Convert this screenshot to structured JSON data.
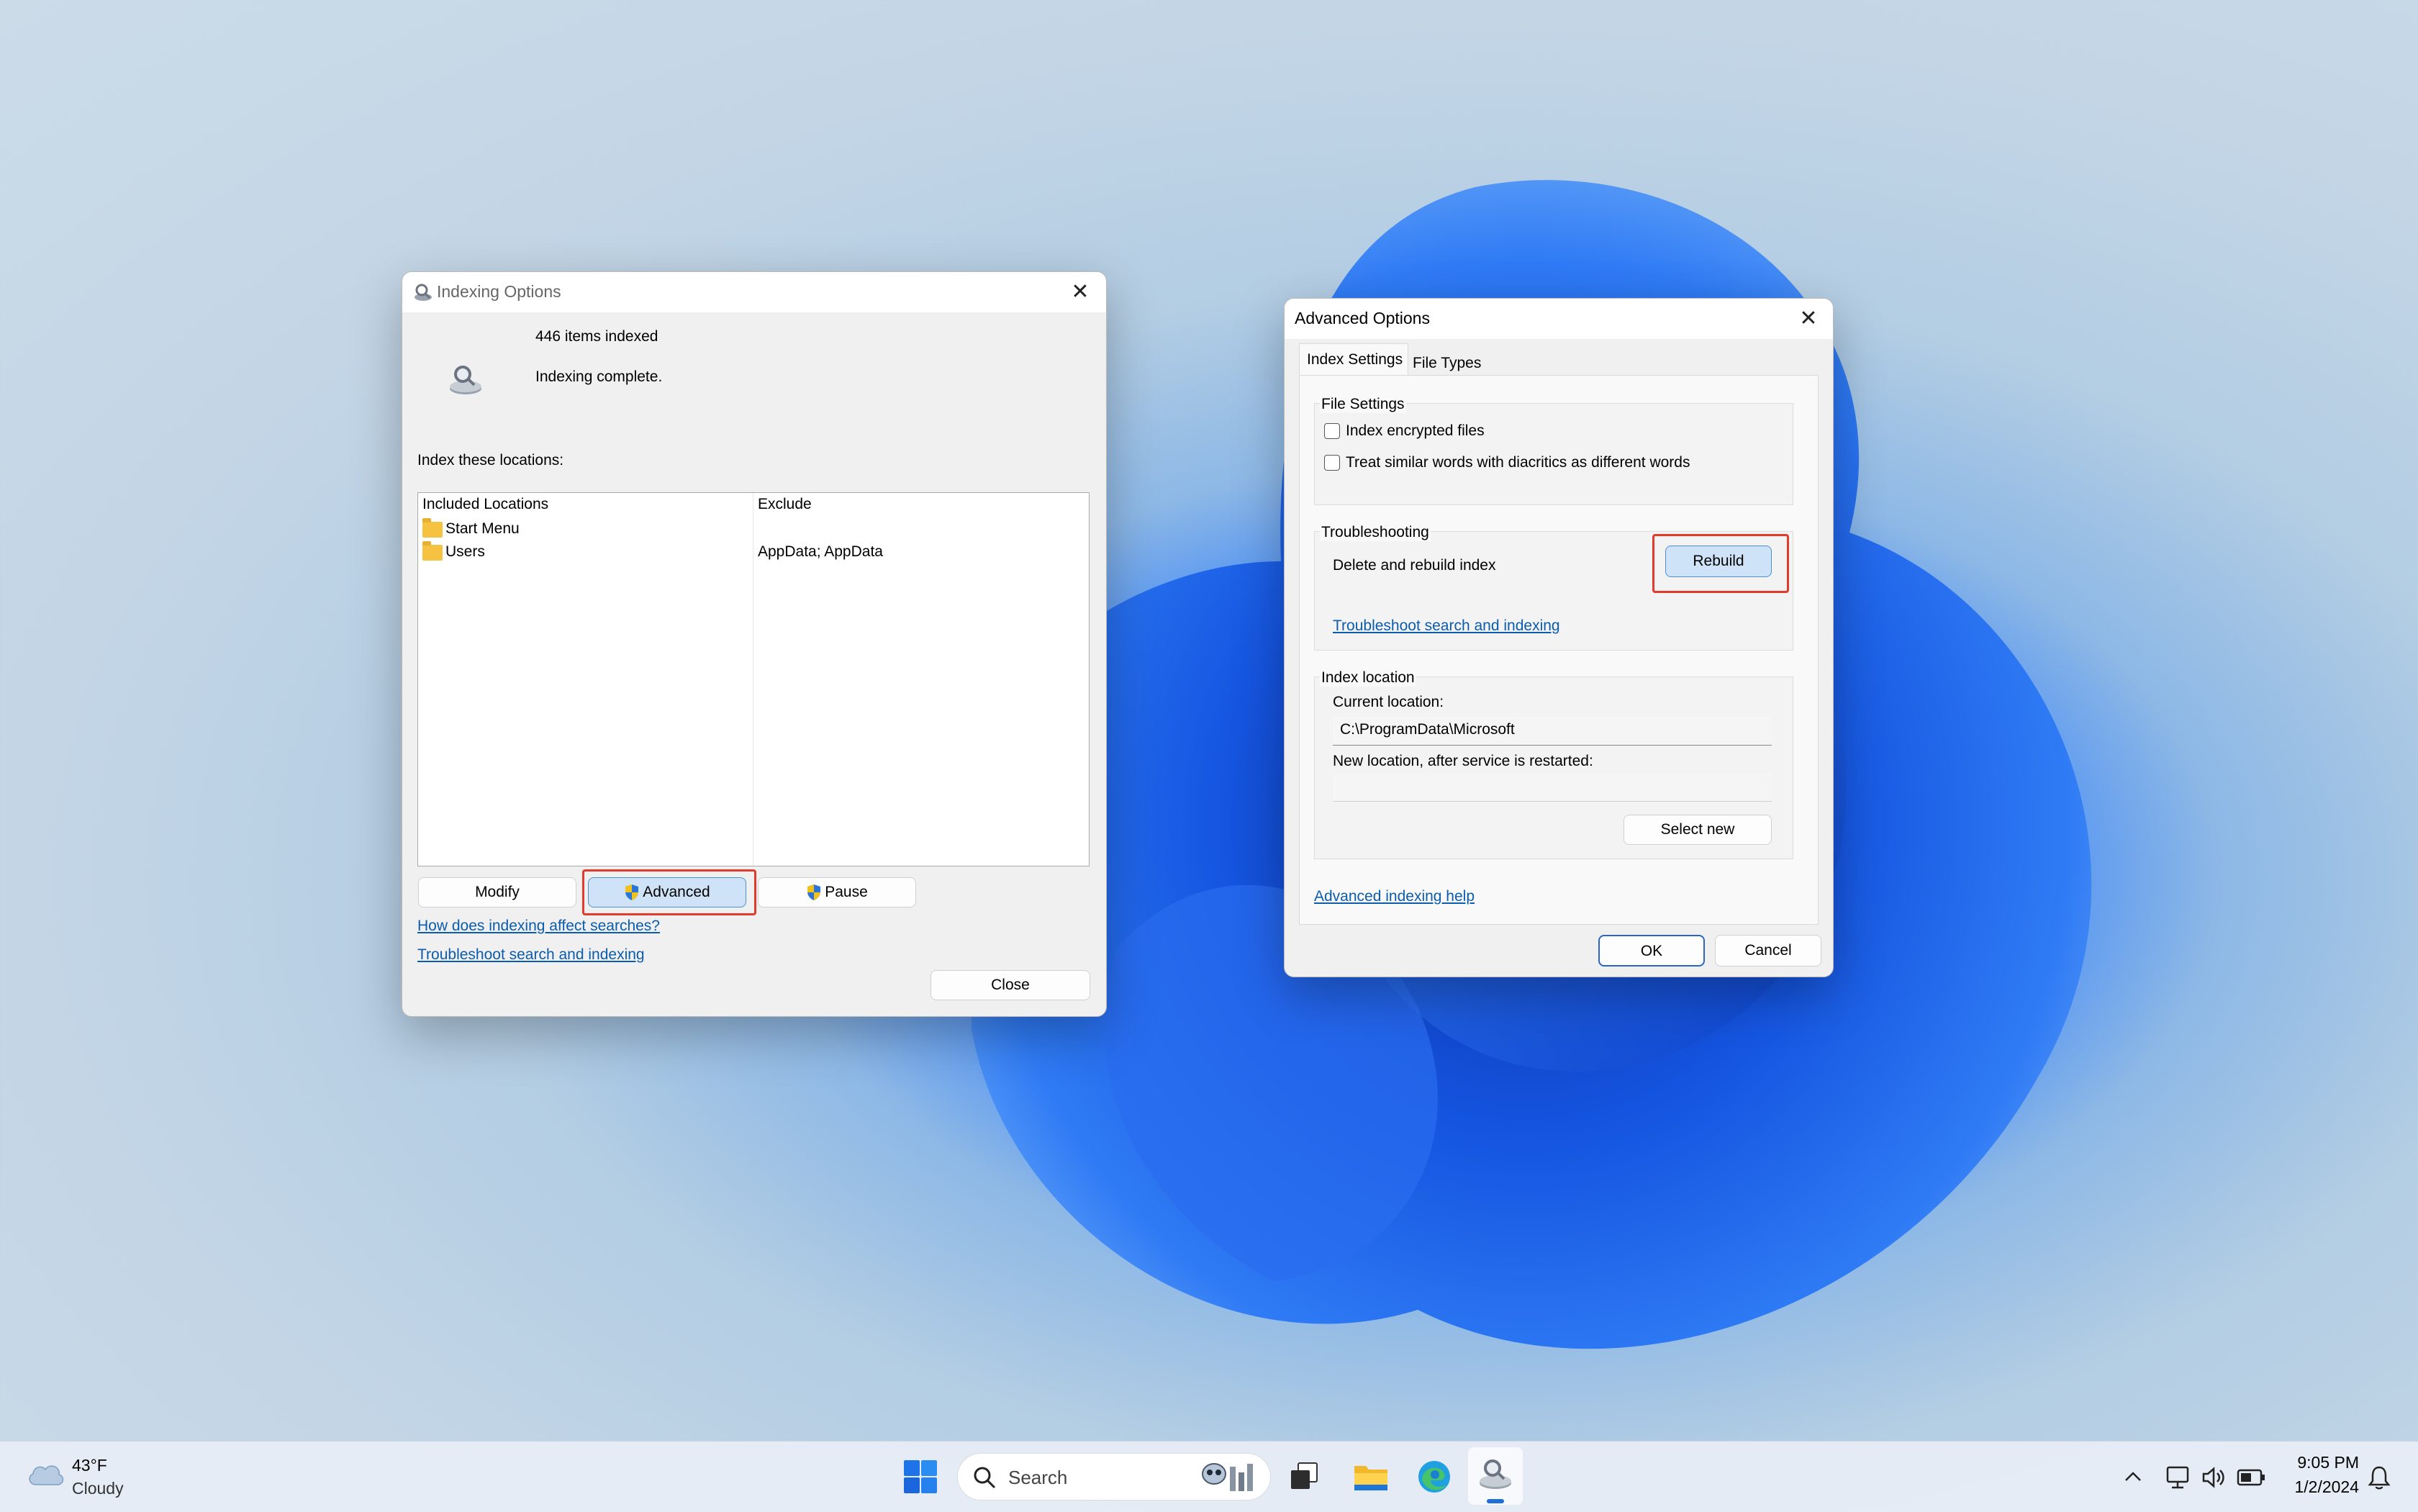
{
  "weather": {
    "temp": "43°F",
    "condition": "Cloudy"
  },
  "indexing_options": {
    "title": "Indexing Options",
    "items_indexed": "446 items indexed",
    "status": "Indexing complete.",
    "locations_label": "Index these locations:",
    "columns": {
      "included": "Included Locations",
      "exclude": "Exclude"
    },
    "rows": [
      {
        "location": "Start Menu",
        "exclude": ""
      },
      {
        "location": "Users",
        "exclude": "AppData; AppData"
      }
    ],
    "buttons": {
      "modify": "Modify",
      "advanced": "Advanced",
      "pause": "Pause",
      "close": "Close"
    },
    "links": {
      "how": "How does indexing affect searches?",
      "troubleshoot": "Troubleshoot search and indexing"
    }
  },
  "advanced_options": {
    "title": "Advanced Options",
    "tabs": [
      "Index Settings",
      "File Types"
    ],
    "file_settings": {
      "legend": "File Settings",
      "encrypted": "Index encrypted files",
      "diacritics": "Treat similar words with diacritics as different words"
    },
    "troubleshooting": {
      "legend": "Troubleshooting",
      "delete_label": "Delete and rebuild index",
      "rebuild": "Rebuild",
      "link": "Troubleshoot search and indexing"
    },
    "index_location": {
      "legend": "Index location",
      "current_label": "Current location:",
      "current_value": "C:\\ProgramData\\Microsoft",
      "new_label": "New location, after service is restarted:",
      "new_value": "",
      "select_new": "Select new"
    },
    "help_link": "Advanced indexing help",
    "ok": "OK",
    "cancel": "Cancel"
  },
  "taskbar": {
    "search_placeholder": "Search",
    "time": "9:05 PM",
    "date": "1/2/2024"
  }
}
